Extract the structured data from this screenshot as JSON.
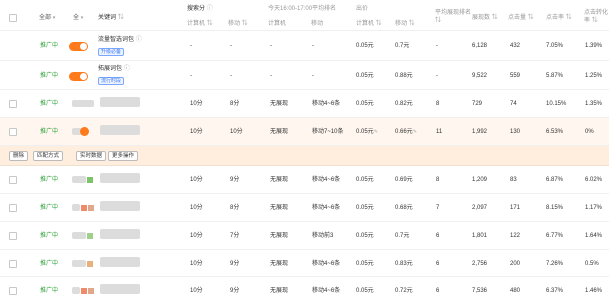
{
  "header": {
    "filter_all": "全部",
    "filter_all2": "全",
    "keyword": "关键词",
    "bid": "搜索分",
    "pc_rank": "计算机",
    "mobile_rank": "移动",
    "time_range": "今天16:00-17:00平均排名",
    "pc": "计算机",
    "mobile": "移动",
    "price": "出价",
    "price_pc": "计算机",
    "price_mobile": "移动",
    "avg_rank": "平均展现排名",
    "impressions": "展现数",
    "clicks": "点击量",
    "ctr": "点击率",
    "conv_rate": "点击转化率"
  },
  "package_rows": [
    {
      "status": "推广中",
      "name": "流量智选词包",
      "tag": "升级必备",
      "bid1": "-",
      "bid2": "-",
      "pc": "-",
      "mob": "-",
      "price_pc": "0.05元",
      "price_mob": "0.7元",
      "avg": "-",
      "imp": "6,128",
      "clk": "432",
      "ctr": "7.05%",
      "conv": "1.39%"
    },
    {
      "status": "推广中",
      "name": "拓展词包",
      "tag": "流行时段",
      "bid1": "-",
      "bid2": "-",
      "pc": "-",
      "mob": "-",
      "price_pc": "0.05元",
      "price_mob": "0.88元",
      "avg": "-",
      "imp": "9,522",
      "clk": "559",
      "ctr": "5.87%",
      "conv": "1.25%"
    }
  ],
  "keyword_rows": [
    {
      "status": "推广中",
      "bid1": "10分",
      "bid2": "8分",
      "pc": "无展现",
      "mob": "移动4~6条",
      "price_pc": "0.05元",
      "price_mob": "0.82元",
      "avg": "8",
      "imp": "729",
      "clk": "74",
      "ctr": "10.15%",
      "conv": "1.35%"
    },
    {
      "status": "推广中",
      "bid1": "10分",
      "bid2": "10分",
      "pc": "无展现",
      "mob": "移动7~10条",
      "price_pc": "0.05元",
      "price_mob": "0.66元",
      "avg": "11",
      "imp": "1,992",
      "clk": "130",
      "ctr": "6.53%",
      "conv": "0%"
    },
    {
      "status": "推广中",
      "bid1": "10分",
      "bid2": "9分",
      "pc": "无展现",
      "mob": "移动4~6条",
      "price_pc": "0.05元",
      "price_mob": "0.69元",
      "avg": "8",
      "imp": "1,209",
      "clk": "83",
      "ctr": "6.87%",
      "conv": "6.02%"
    },
    {
      "status": "推广中",
      "bid1": "10分",
      "bid2": "8分",
      "pc": "无展现",
      "mob": "移动4~6条",
      "price_pc": "0.05元",
      "price_mob": "0.68元",
      "avg": "7",
      "imp": "2,097",
      "clk": "171",
      "ctr": "8.15%",
      "conv": "1.17%"
    },
    {
      "status": "推广中",
      "bid1": "10分",
      "bid2": "7分",
      "pc": "无展现",
      "mob": "移动前3",
      "price_pc": "0.05元",
      "price_mob": "0.7元",
      "avg": "6",
      "imp": "1,801",
      "clk": "122",
      "ctr": "6.77%",
      "conv": "1.64%"
    },
    {
      "status": "推广中",
      "bid1": "10分",
      "bid2": "9分",
      "pc": "无展现",
      "mob": "移动4~6条",
      "price_pc": "0.05元",
      "price_mob": "0.83元",
      "avg": "6",
      "imp": "2,756",
      "clk": "200",
      "ctr": "7.26%",
      "conv": "0.5%"
    },
    {
      "status": "推广中",
      "bid1": "10分",
      "bid2": "9分",
      "pc": "无展现",
      "mob": "移动4~6条",
      "price_pc": "0.05元",
      "price_mob": "0.72元",
      "avg": "6",
      "imp": "7,536",
      "clk": "480",
      "ctr": "6.37%",
      "conv": "1.46%"
    }
  ],
  "actions": {
    "delete": "删除",
    "match": "匹配方式",
    "realtime": "实时数据",
    "more": "更多操作"
  },
  "colors": {
    "accent": "#ff7a1a",
    "status": "#2fa33a",
    "highlight": "#fff6ef"
  }
}
